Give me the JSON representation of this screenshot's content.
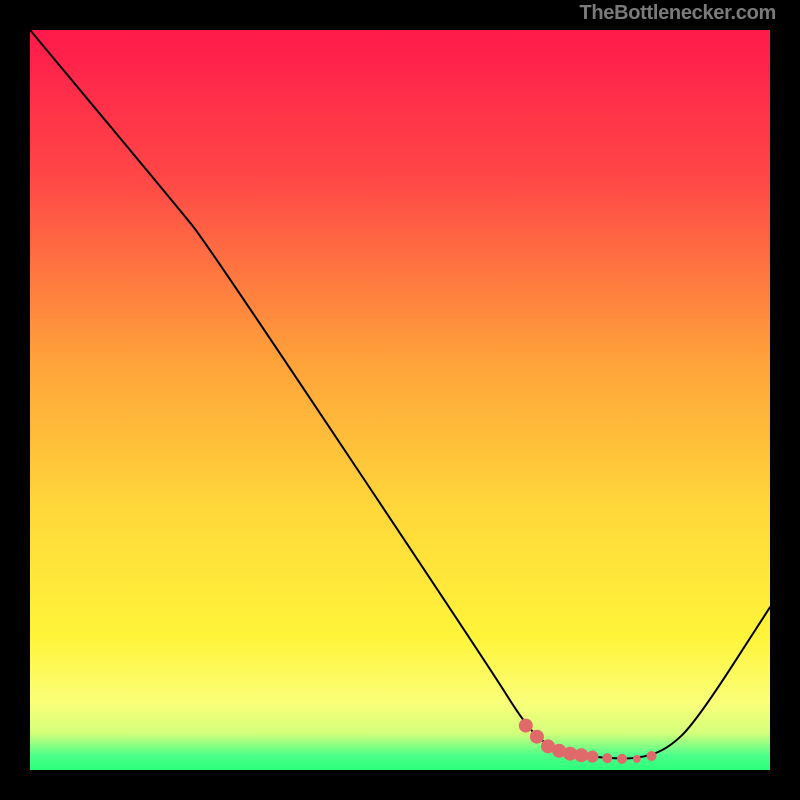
{
  "attribution": "TheBottlenecker.com",
  "chart_data": {
    "type": "line",
    "title": "",
    "xlabel": "",
    "ylabel": "",
    "xlim": [
      0,
      100
    ],
    "ylim": [
      0,
      100
    ],
    "background_gradient_stops": [
      {
        "offset": 0,
        "color": "#ff1a4b"
      },
      {
        "offset": 20,
        "color": "#ff4747"
      },
      {
        "offset": 45,
        "color": "#ffa33a"
      },
      {
        "offset": 65,
        "color": "#ffd83a"
      },
      {
        "offset": 82,
        "color": "#fff43a"
      },
      {
        "offset": 91,
        "color": "#faff7a"
      },
      {
        "offset": 95,
        "color": "#d4ff7a"
      },
      {
        "offset": 98,
        "color": "#4dff8a"
      },
      {
        "offset": 100,
        "color": "#2cff7a"
      }
    ],
    "series": [
      {
        "name": "bottleneck-curve",
        "color": "#000000",
        "stroke_width": 2,
        "points": [
          {
            "x": 0,
            "y": 100
          },
          {
            "x": 20,
            "y": 76
          },
          {
            "x": 24,
            "y": 71
          },
          {
            "x": 62,
            "y": 14
          },
          {
            "x": 67,
            "y": 6
          },
          {
            "x": 70,
            "y": 3.2
          },
          {
            "x": 74,
            "y": 2.0
          },
          {
            "x": 78,
            "y": 1.6
          },
          {
            "x": 82,
            "y": 1.5
          },
          {
            "x": 86,
            "y": 2.7
          },
          {
            "x": 90,
            "y": 6.5
          },
          {
            "x": 100,
            "y": 22
          }
        ]
      }
    ],
    "marker_series": {
      "name": "highlighted-range",
      "color": "#e06a6a",
      "points": [
        {
          "x": 67,
          "y": 6,
          "r": 7
        },
        {
          "x": 68.5,
          "y": 4.5,
          "r": 7
        },
        {
          "x": 70,
          "y": 3.2,
          "r": 7
        },
        {
          "x": 71.5,
          "y": 2.6,
          "r": 7
        },
        {
          "x": 73,
          "y": 2.2,
          "r": 7
        },
        {
          "x": 74.5,
          "y": 2.0,
          "r": 7
        },
        {
          "x": 76,
          "y": 1.8,
          "r": 6
        },
        {
          "x": 78,
          "y": 1.6,
          "r": 5
        },
        {
          "x": 80,
          "y": 1.5,
          "r": 5
        },
        {
          "x": 82,
          "y": 1.5,
          "r": 4
        },
        {
          "x": 84,
          "y": 1.9,
          "r": 5
        }
      ]
    }
  }
}
